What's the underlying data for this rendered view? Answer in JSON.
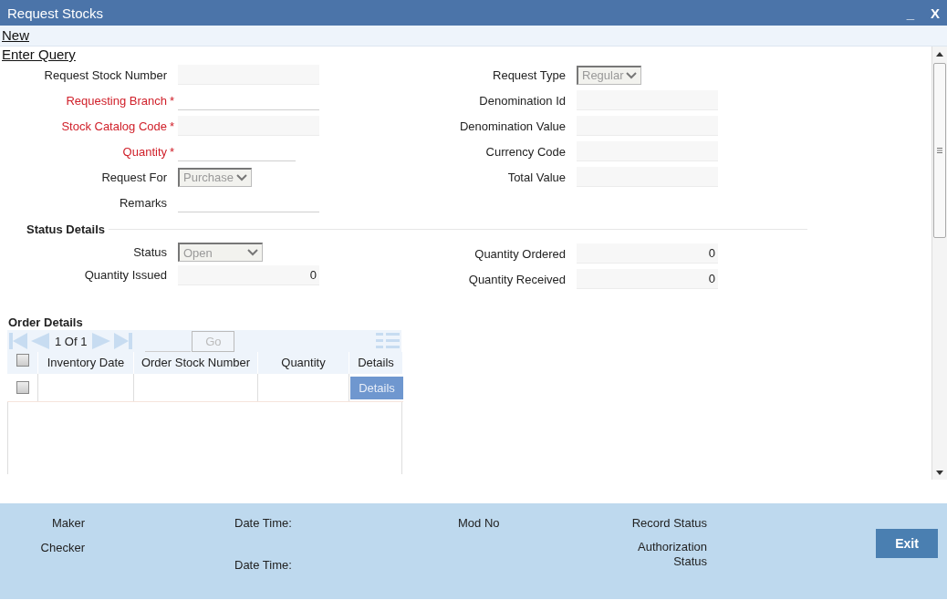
{
  "window": {
    "title": "Request Stocks",
    "minimize": "_",
    "close": "X"
  },
  "toolbar": {
    "links": [
      "New",
      "Enter Query"
    ]
  },
  "form": {
    "left": [
      {
        "label": "Request Stock Number",
        "required": false,
        "kind": "readonly"
      },
      {
        "label": "Requesting Branch",
        "required": true,
        "marker": "*",
        "kind": "input"
      },
      {
        "label": "Stock Catalog Code",
        "required": true,
        "marker": "*",
        "kind": "readonly"
      },
      {
        "label": "Quantity",
        "required": true,
        "marker": "*",
        "kind": "input-short"
      },
      {
        "label": "Request For",
        "required": false,
        "kind": "select",
        "value": "Purchase",
        "disabled": true
      },
      {
        "label": "Remarks",
        "required": false,
        "kind": "input"
      }
    ],
    "right": [
      {
        "label": "Request Type",
        "required": false,
        "kind": "select",
        "value": "Regular",
        "disabled": true
      },
      {
        "label": "Denomination Id",
        "required": false,
        "kind": "readonly"
      },
      {
        "label": "Denomination Value",
        "required": false,
        "kind": "readonly"
      },
      {
        "label": "Currency Code",
        "required": false,
        "kind": "readonly"
      },
      {
        "label": "Total Value",
        "required": false,
        "kind": "readonly"
      }
    ]
  },
  "status_details": {
    "heading": "Status Details",
    "left": [
      {
        "label": "Status",
        "required": false,
        "kind": "select-wide",
        "value": "Open",
        "disabled": true
      },
      {
        "label": "Quantity Issued",
        "required": false,
        "kind": "readonly",
        "value": "0"
      }
    ],
    "right": [
      {
        "label": "Quantity Ordered",
        "required": false,
        "kind": "readonly",
        "value": "0"
      },
      {
        "label": "Quantity Received",
        "required": false,
        "kind": "readonly",
        "value": "0"
      }
    ]
  },
  "order_details": {
    "heading": "Order Details",
    "pager": {
      "page_text": "1 Of 1",
      "go_button": "Go",
      "go_disabled": true
    },
    "select_all_checked": false,
    "columns": [
      "Inventory Date",
      "Order Stock Number",
      "Quantity",
      "Details"
    ],
    "rows": [
      {
        "checked": false,
        "details_button": "Details"
      }
    ]
  },
  "footer": {
    "maker": "Maker",
    "maker_date_time": "Date Time:",
    "mod_no": "Mod No",
    "record_status": "Record Status",
    "checker": "Checker",
    "checker_date_time": "Date Time:",
    "authorization_status": "Authorization Status",
    "exit_button": "Exit"
  }
}
